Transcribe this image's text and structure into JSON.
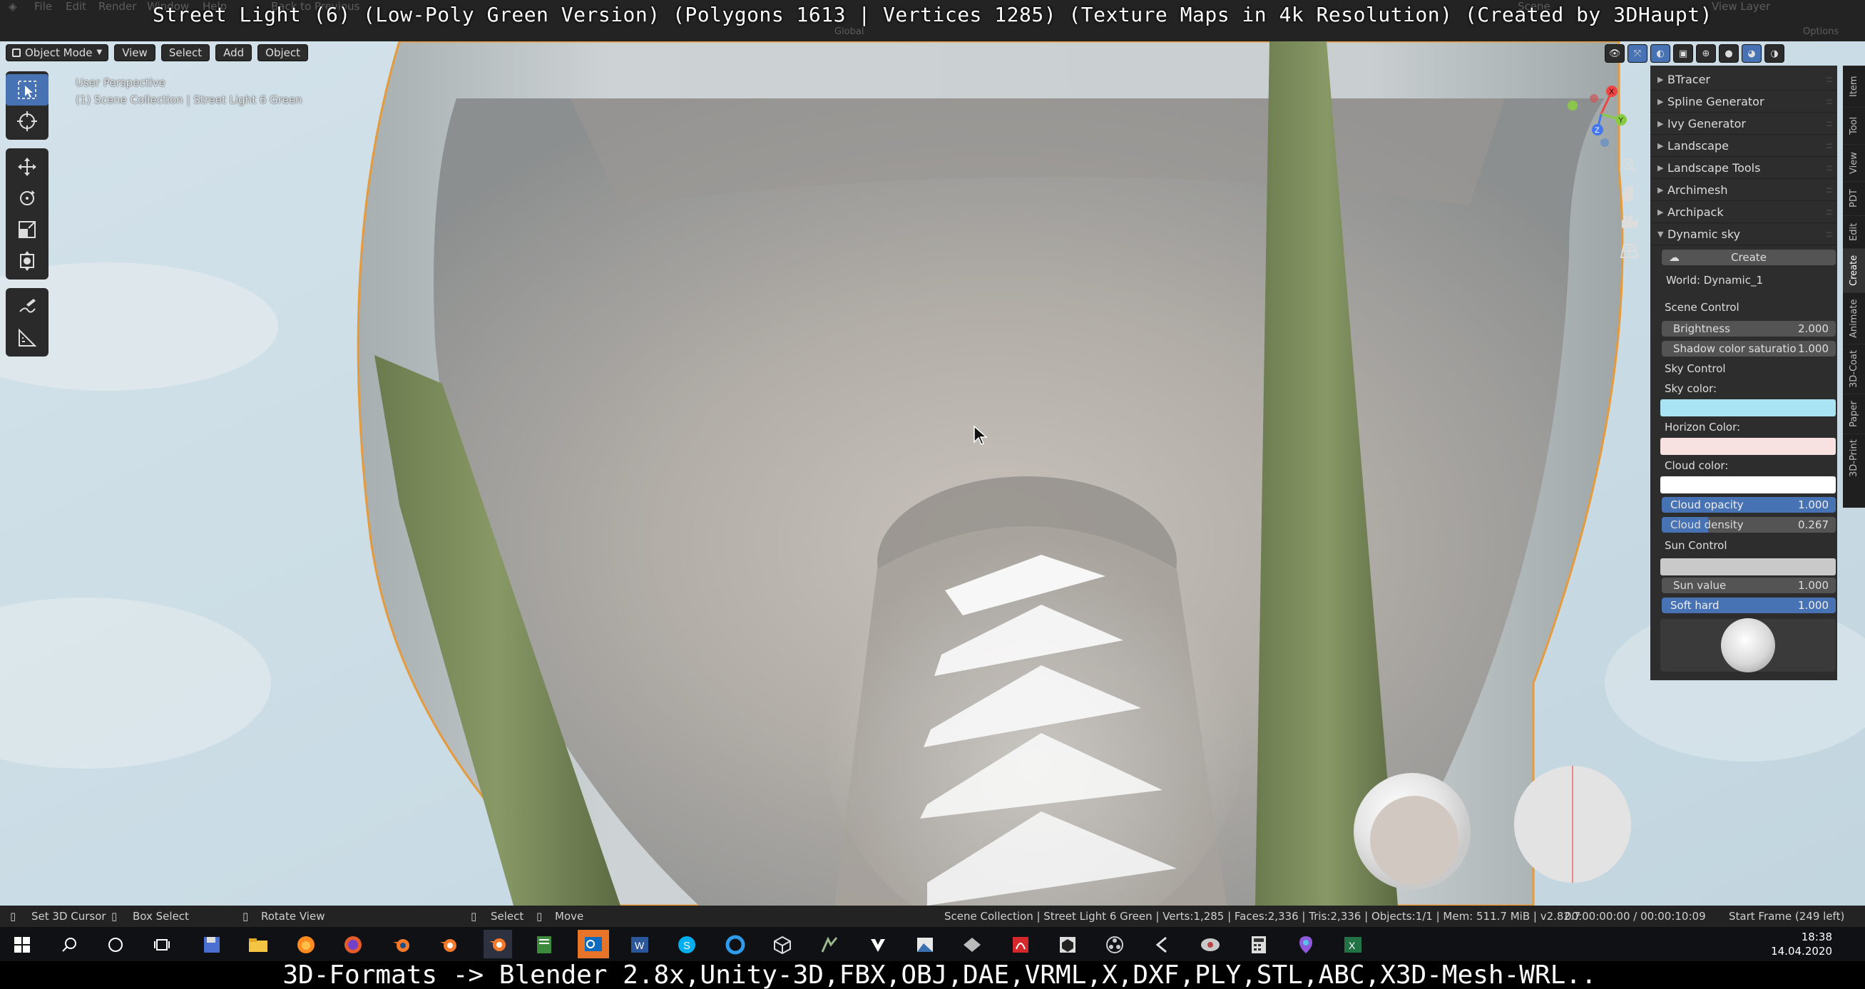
{
  "window": {
    "title_overlay": "Street Light (6) (Low-Poly Green Version) (Polygons 1613 | Vertices 1285) (Texture Maps in 4k Resolution) (Created by 3DHaupt)",
    "formats_caption": "3D-Formats -> Blender 2.8x,Unity-3D,FBX,OBJ,DAE,VRML,X,DXF,PLY,STL,ABC,X3D-Mesh-WRL.."
  },
  "topbar": {
    "menus": [
      "File",
      "Edit",
      "Render",
      "Window",
      "Help"
    ],
    "back_label": "Back to Previous",
    "scene_label": "Scene",
    "view_layer_label": "View Layer",
    "options_label": "Options",
    "global_label": "Global"
  },
  "viewport_header": {
    "mode": "Object Mode",
    "menus": [
      "View",
      "Select",
      "Add",
      "Object"
    ]
  },
  "viewport_info": {
    "perspective": "User Perspective",
    "collection": "(1) Scene Collection | Street Light 6 Green"
  },
  "toolbar": {
    "tools": [
      "select-box-tool",
      "cursor-tool",
      "move-tool",
      "rotate-tool",
      "scale-tool",
      "transform-tool",
      "annotate-tool",
      "measure-tool"
    ]
  },
  "gizmo": {
    "x": "X",
    "y": "Y",
    "z": "Z"
  },
  "sidebar": {
    "panels": [
      {
        "label": "BTracer",
        "open": false
      },
      {
        "label": "Spline Generator",
        "open": false
      },
      {
        "label": "Ivy Generator",
        "open": false
      },
      {
        "label": "Landscape",
        "open": false
      },
      {
        "label": "Landscape Tools",
        "open": false
      },
      {
        "label": "Archimesh",
        "open": false
      },
      {
        "label": "Archipack",
        "open": false
      },
      {
        "label": "Dynamic sky",
        "open": true
      }
    ],
    "dynamic_sky": {
      "create_label": "Create",
      "world_label": "World: Dynamic_1",
      "scene_control": "Scene Control",
      "brightness_label": "Brightness",
      "brightness_value": "2.000",
      "shadow_label": "Shadow color saturatio",
      "shadow_value": "1.000",
      "sky_control": "Sky Control",
      "sky_color_label": "Sky color:",
      "horizon_color_label": "Horizon Color:",
      "cloud_color_label": "Cloud color:",
      "cloud_opacity_label": "Cloud opacity",
      "cloud_opacity_value": "1.000",
      "cloud_density_label": "Cloud density",
      "cloud_density_value": "0.267",
      "sun_control": "Sun Control",
      "sun_value_label": "Sun value",
      "sun_value_value": "1.000",
      "soft_hard_label": "Soft hard",
      "soft_hard_value": "1.000"
    },
    "colors": {
      "sky": "#a9e4f4",
      "horizon": "#f8e2e1",
      "cloud": "#ffffff",
      "sun": "#c9c9c9"
    }
  },
  "tabs": [
    "Item",
    "Tool",
    "View",
    "PDT",
    "Edit",
    "Create",
    "Animate",
    "3D-Coat",
    "Paper",
    "3D-Print"
  ],
  "active_tab": "Create",
  "statusbar": {
    "set_cursor": "Set 3D Cursor",
    "box_select": "Box Select",
    "rotate_view": "Rotate View",
    "select": "Select",
    "move": "Move",
    "stats": "Scene Collection | Street Light 6 Green | Verts:1,285 | Faces:2,336 | Tris:2,336 | Objects:1/1 | Mem: 511.7 MiB | v2.82.7",
    "timecode": "00:00:00:00 / 00:00:10:09",
    "start_frame": "Start Frame (249 left)"
  },
  "taskbar": {
    "time": "18:38",
    "date": "14.04.2020"
  }
}
